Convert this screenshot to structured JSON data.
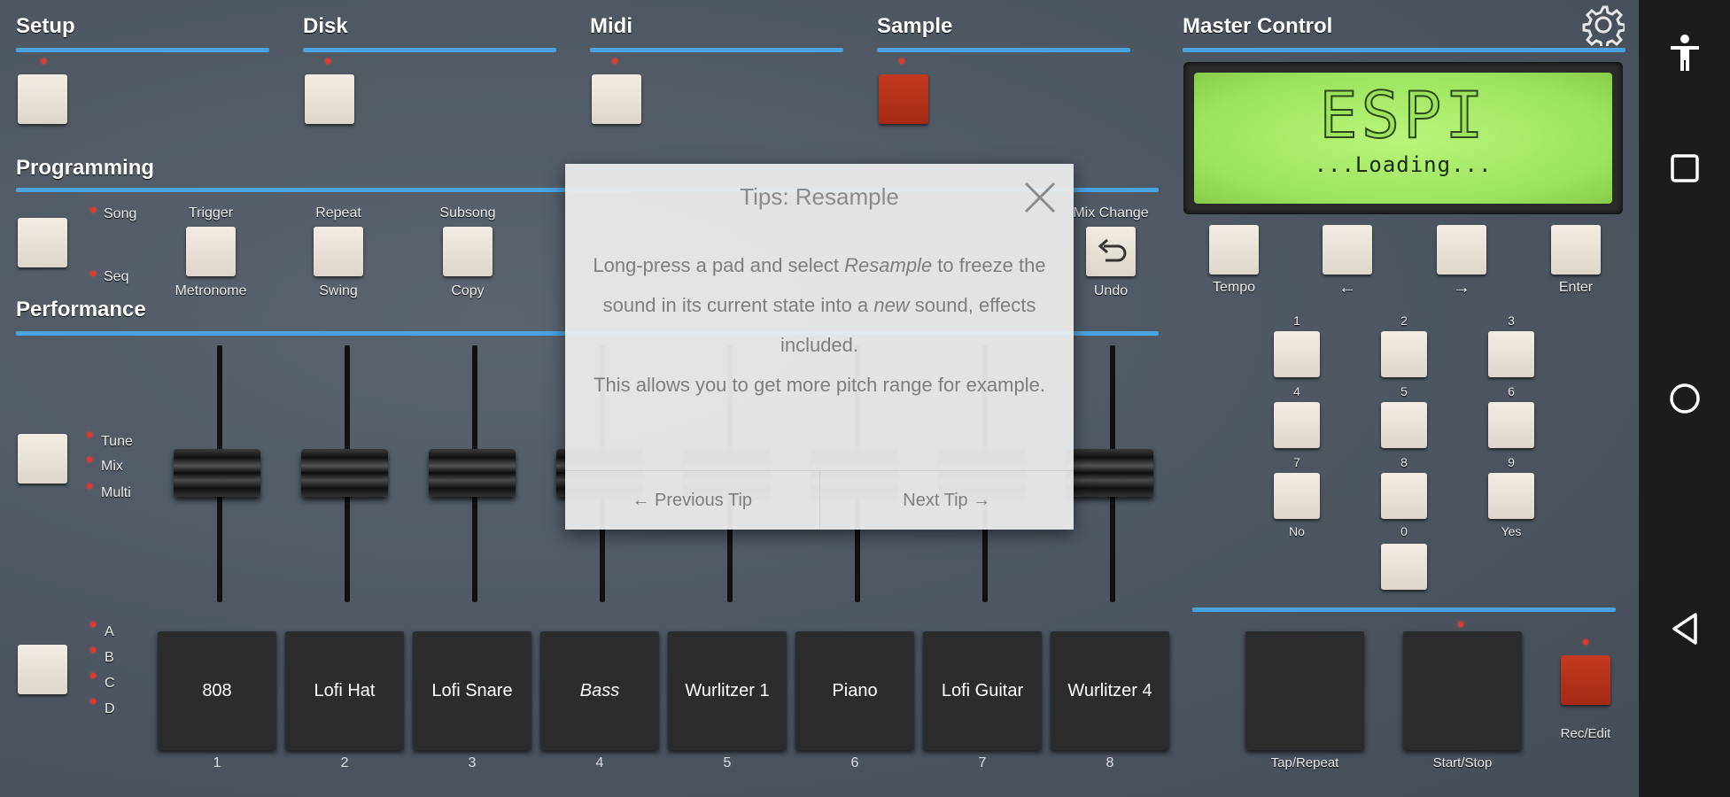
{
  "sections": {
    "setup": "Setup",
    "disk": "Disk",
    "midi": "Midi",
    "sample": "Sample",
    "master": "Master Control",
    "programming": "Programming",
    "performance": "Performance"
  },
  "programming": {
    "song": "Song",
    "seq": "Seq",
    "trigger": "Trigger",
    "metronome": "Metronome",
    "repeat": "Repeat",
    "swing": "Swing",
    "subsong": "Subsong",
    "copy": "Copy",
    "mix_change": "Mix Change",
    "undo": "Undo"
  },
  "performance": {
    "tune": "Tune",
    "mix": "Mix",
    "multi": "Multi",
    "banks": [
      "A",
      "B",
      "C",
      "D"
    ]
  },
  "pads": [
    {
      "name": "808",
      "num": "1"
    },
    {
      "name": "Lofi Hat",
      "num": "2"
    },
    {
      "name": "Lofi Snare",
      "num": "3"
    },
    {
      "name": "Bass",
      "num": "4"
    },
    {
      "name": "Wurlitzer 1",
      "num": "5"
    },
    {
      "name": "Piano",
      "num": "6"
    },
    {
      "name": "Lofi Guitar",
      "num": "7"
    },
    {
      "name": "Wurlitzer 4",
      "num": "8"
    }
  ],
  "lcd": {
    "logo": "ESPI",
    "status": "...Loading..."
  },
  "master": {
    "tempo": "Tempo",
    "left": "←",
    "right": "→",
    "enter": "Enter",
    "keys": [
      "1",
      "2",
      "3",
      "4",
      "5",
      "6",
      "7",
      "8",
      "9",
      "0"
    ],
    "no": "No",
    "yes": "Yes",
    "tap_repeat": "Tap/Repeat",
    "start_stop": "Start/Stop",
    "rec_edit": "Rec/Edit"
  },
  "dialog": {
    "title": "Tips: Resample",
    "body_pre": "Long-press a pad and select ",
    "body_em1": "Resample",
    "body_mid": " to freeze the sound in its current state into a ",
    "body_em2": "new",
    "body_post": " sound, effects included.",
    "body2": "This allows you to get more pitch range for example.",
    "prev": "← Previous Tip",
    "next": "Next Tip →"
  },
  "colors": {
    "accent": "#4aa3df",
    "led": "#e23a2a",
    "lcd": "#9ce45e",
    "active_button": "#b3301a"
  }
}
